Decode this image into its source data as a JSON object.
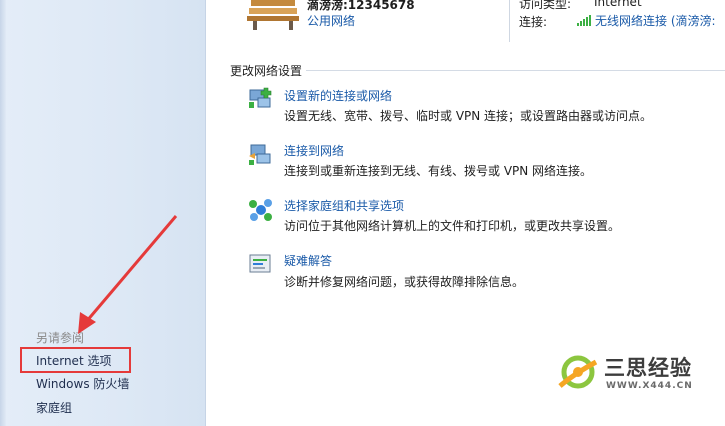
{
  "network": {
    "name": "滴滂滂:12345678",
    "type": "公用网络",
    "access_type_label": "访问类型:",
    "access_type_value": "Internet",
    "connection_label": "连接:",
    "connection_value": "无线网络连接 (滴滂滂:"
  },
  "change_settings": {
    "title": "更改网络设置",
    "tasks": [
      {
        "link": "设置新的连接或网络",
        "desc": "设置无线、宽带、拨号、临时或 VPN 连接；或设置路由器或访问点。",
        "icon": "new-connection-icon"
      },
      {
        "link": "连接到网络",
        "desc": "连接到或重新连接到无线、有线、拨号或 VPN 网络连接。",
        "icon": "connect-network-icon"
      },
      {
        "link": "选择家庭组和共享选项",
        "desc": "访问位于其他网络计算机上的文件和打印机，或更改共享设置。",
        "icon": "homegroup-icon"
      },
      {
        "link": "疑难解答",
        "desc": "诊断并修复网络问题，或获得故障排除信息。",
        "icon": "troubleshoot-icon"
      }
    ]
  },
  "see_also": {
    "title": "另请参阅",
    "links": [
      "Internet 选项",
      "Windows 防火墙",
      "家庭组"
    ]
  },
  "watermark": {
    "title": "三思经验",
    "subtitle": "WWW.X444.CN"
  },
  "colors": {
    "link": "#1a5aa8",
    "highlight": "#e53a3a",
    "nav_bg": "#dde8f5"
  }
}
